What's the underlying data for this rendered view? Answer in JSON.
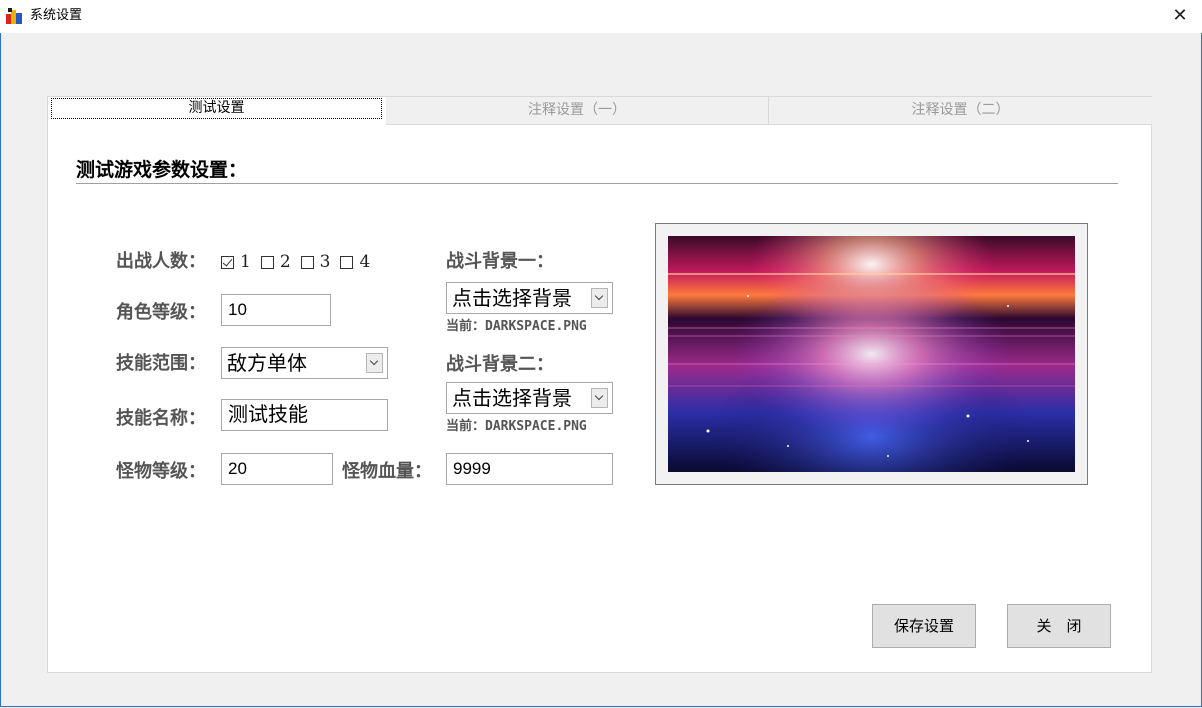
{
  "window": {
    "title": "系统设置",
    "close_glyph": "✕"
  },
  "tabs": [
    {
      "label": "测试设置",
      "active": true
    },
    {
      "label": "注释设置（一）",
      "active": false
    },
    {
      "label": "注释设置（二）",
      "active": false
    }
  ],
  "section": {
    "title": "测试游戏参数设置："
  },
  "form": {
    "party_count": {
      "label": "出战人数：",
      "options": [
        {
          "label": "1",
          "checked": true
        },
        {
          "label": "2",
          "checked": false
        },
        {
          "label": "3",
          "checked": false
        },
        {
          "label": "4",
          "checked": false
        }
      ]
    },
    "character_level": {
      "label": "角色等级：",
      "value": "10"
    },
    "skill_range": {
      "label": "技能范围：",
      "value": "敌方单体"
    },
    "skill_name": {
      "label": "技能名称：",
      "value": "测试技能"
    },
    "monster_level": {
      "label": "怪物等级：",
      "value": "20"
    },
    "monster_hp": {
      "label": "怪物血量：",
      "value": "9999"
    },
    "battle_bg_1": {
      "label": "战斗背景一：",
      "select": "点击选择背景",
      "current": "当前：DARKSPACE.PNG"
    },
    "battle_bg_2": {
      "label": "战斗背景二：",
      "select": "点击选择背景",
      "current": "当前：DARKSPACE.PNG"
    }
  },
  "buttons": {
    "save": "保存设置",
    "close": "关　闭"
  },
  "icons": {
    "app": "app-icon",
    "close": "close-icon",
    "dropdown": "chevron-down-icon",
    "checkbox": "checkbox-icon"
  },
  "colors": {
    "window_border": "#2b6fc9",
    "panel_bg": "#ffffff",
    "body_bg": "#f0f0f0",
    "button_bg": "#e1e1e1"
  }
}
